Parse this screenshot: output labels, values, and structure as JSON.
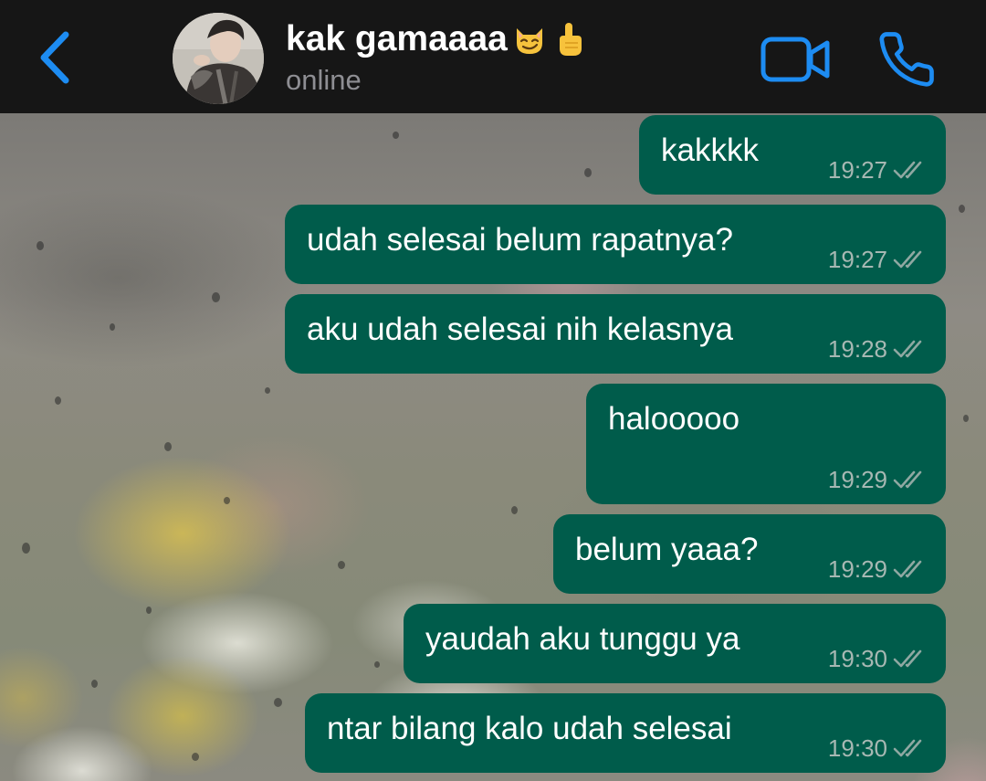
{
  "header": {
    "contact_name": "kak gamaaaa",
    "contact_status": "online",
    "name_emojis": [
      "smirking-cat-face",
      "index-pointing-up"
    ]
  },
  "colors": {
    "header_bg": "#161616",
    "accent_blue": "#1d8cf2",
    "bubble_bg": "#005c4b",
    "message_text": "#ffffff",
    "time_text": "#a7b8b3",
    "status_text": "#8e8e93"
  },
  "messages": [
    {
      "text": "kakkkk",
      "time": "19:27",
      "status": "read",
      "direction": "outgoing"
    },
    {
      "text": "udah selesai belum rapatnya?",
      "time": "19:27",
      "status": "read",
      "direction": "outgoing"
    },
    {
      "text": "aku udah selesai nih kelasnya",
      "time": "19:28",
      "status": "read",
      "direction": "outgoing"
    },
    {
      "text": "halooooo",
      "time": "19:29",
      "status": "read",
      "direction": "outgoing"
    },
    {
      "text": "belum yaaa?",
      "time": "19:29",
      "status": "read",
      "direction": "outgoing"
    },
    {
      "text": "yaudah aku tunggu ya",
      "time": "19:30",
      "status": "read",
      "direction": "outgoing"
    },
    {
      "text": "ntar bilang kalo udah selesai",
      "time": "19:30",
      "status": "read",
      "direction": "outgoing"
    }
  ]
}
